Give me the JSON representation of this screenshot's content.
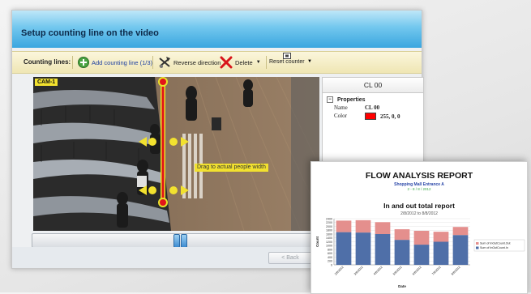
{
  "window": {
    "title": "Setup counting line on the video"
  },
  "toolbar": {
    "label": "Counting lines:",
    "add_label": "Add counting line (1/3)",
    "reverse_label": "Reverse direction",
    "delete_label": "Delete",
    "reset_label": "Reset counter"
  },
  "video": {
    "camera_label": "CAM-1",
    "drag_hint": "Drag to actual people width"
  },
  "properties": {
    "header": "CL 00",
    "section": "Properties",
    "name_key": "Name",
    "name_value": "CL 00",
    "color_key": "Color",
    "color_value": "255, 0, 0",
    "color_hex": "#ff0000"
  },
  "navigation": {
    "back_label": "< Back"
  },
  "report": {
    "title": "FLOW ANALYSIS REPORT",
    "subtitle": "Shopping Mall Entrance A",
    "date_range": "2 - 8 / 8 / 2012",
    "chart_title": "In and out total report",
    "chart_date": "2/8/2012 to 8/8/2012"
  },
  "chart_data": {
    "type": "bar",
    "stacked": true,
    "categories": [
      "2/8/2012",
      "3/8/2012",
      "4/8/2012",
      "5/8/2012",
      "6/8/2012",
      "7/8/2012",
      "8/8/2012"
    ],
    "series": [
      {
        "name": "Sum of InOutCount.In",
        "color": "#4f6fa8",
        "values": [
          1700,
          1680,
          1600,
          1300,
          1050,
          1200,
          1550
        ]
      },
      {
        "name": "Sum of InOutCount.Out",
        "color": "#e48f8d",
        "values": [
          600,
          640,
          620,
          550,
          720,
          520,
          420
        ]
      }
    ],
    "yticks": [
      0,
      200,
      400,
      600,
      800,
      1000,
      1200,
      1400,
      1600,
      1800,
      2000,
      2200,
      2400
    ],
    "ylim": [
      0,
      2400
    ],
    "xlabel": "Date",
    "ylabel": "Count",
    "legend_placement": "right"
  }
}
